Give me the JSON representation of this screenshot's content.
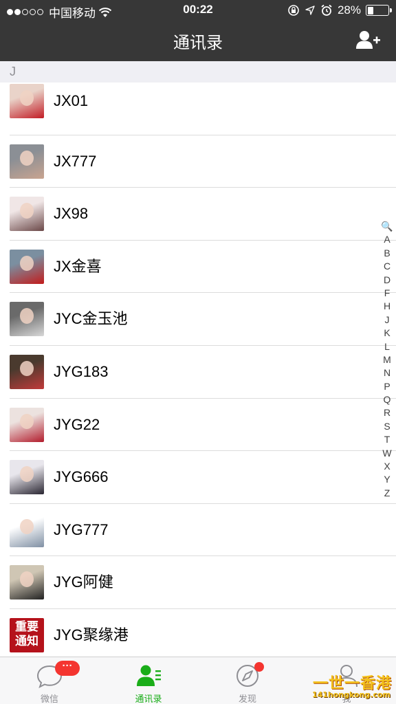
{
  "status_bar": {
    "carrier": "中国移动",
    "time": "00:22",
    "battery": "28%",
    "battery_level": 0.28,
    "signal_icon": "signal-dots-icon",
    "wifi_icon": "wifi-icon"
  },
  "nav": {
    "title": "通讯录",
    "add_icon": "add-contact-icon"
  },
  "section": {
    "letter": "J"
  },
  "contacts": [
    {
      "name": "JX01",
      "avatar_colors": [
        "#e9d3c9",
        "#c21c25"
      ]
    },
    {
      "name": "JX777",
      "avatar_colors": [
        "#8b8f95",
        "#c9a490"
      ]
    },
    {
      "name": "JX98",
      "avatar_colors": [
        "#f0e6e6",
        "#6b4848"
      ]
    },
    {
      "name": "JX金喜",
      "avatar_colors": [
        "#7b8fa0",
        "#c21c1c"
      ]
    },
    {
      "name": "JYC金玉池",
      "avatar_colors": [
        "#6a6a6a",
        "#d8d8d8"
      ]
    },
    {
      "name": "JYG183",
      "avatar_colors": [
        "#4a3a2e",
        "#c23a3a"
      ]
    },
    {
      "name": "JYG22",
      "avatar_colors": [
        "#ece2df",
        "#b21c2c"
      ]
    },
    {
      "name": "JYG666",
      "avatar_colors": [
        "#e8e6ec",
        "#2a2632"
      ]
    },
    {
      "name": "JYG777",
      "avatar_colors": [
        "#ffffff",
        "#8090a4"
      ]
    },
    {
      "name": "JYG阿健",
      "avatar_colors": [
        "#cfc6b4",
        "#222222"
      ]
    },
    {
      "name": "JYG聚缘港",
      "avatar_text": "重要\n通知",
      "avatar_colors": [
        "#b5121b",
        "#ffffff"
      ]
    }
  ],
  "index_bar": [
    "🔍",
    "A",
    "B",
    "C",
    "D",
    "F",
    "H",
    "J",
    "K",
    "L",
    "M",
    "N",
    "P",
    "Q",
    "R",
    "S",
    "T",
    "W",
    "X",
    "Y",
    "Z"
  ],
  "tabs": [
    {
      "label": "微信",
      "icon": "chat-bubble-icon",
      "badge": "···"
    },
    {
      "label": "通讯录",
      "icon": "contacts-icon",
      "active": true
    },
    {
      "label": "发现",
      "icon": "compass-icon"
    },
    {
      "label": "我",
      "icon": "person-icon"
    }
  ],
  "watermark": {
    "text": "一世一香港",
    "sub": "141hongkong.com"
  },
  "colors": {
    "nav_bg": "#373737",
    "accent_green": "#1aad19",
    "badge_red": "#f43530",
    "section_bg": "#efeff4"
  }
}
